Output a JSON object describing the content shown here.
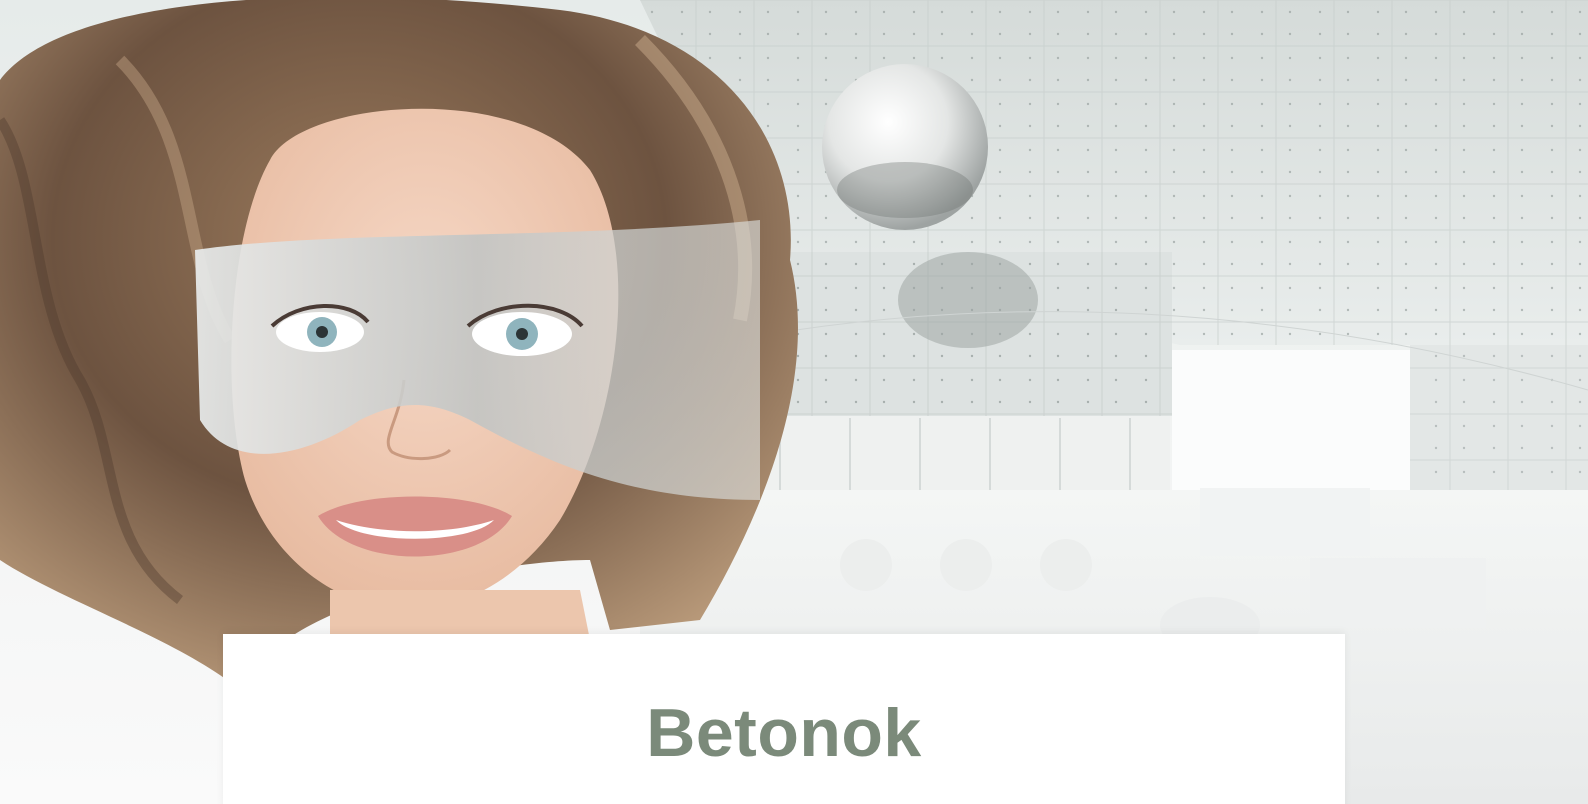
{
  "hero": {
    "image": "woman-with-translucent-mask-over-concrete-interior",
    "title": "Betonok"
  },
  "colors": {
    "title_color": "#7b8a7a",
    "card_background": "#ffffff",
    "concrete_tone": "#dfe5e3"
  }
}
